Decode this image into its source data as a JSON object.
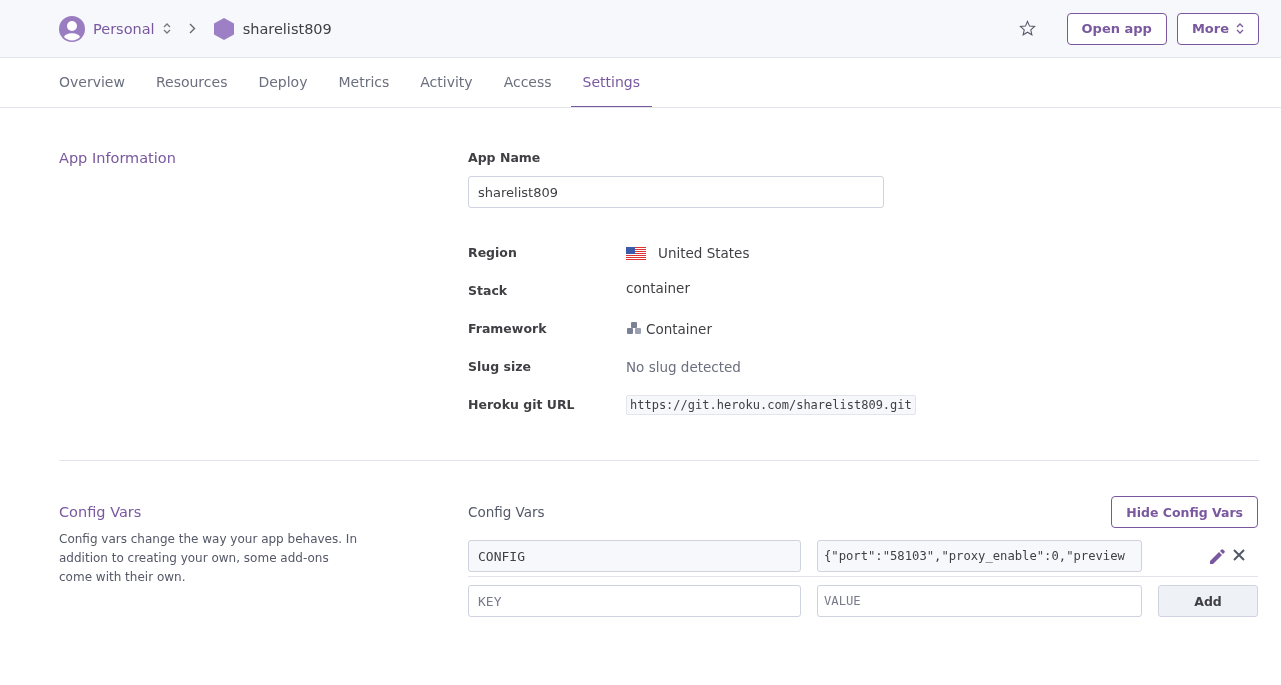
{
  "header": {
    "account": "Personal",
    "app": "sharelist809",
    "buttons": [
      {
        "label": "Open app",
        "kind": "plain"
      },
      {
        "label": "More",
        "kind": "menu"
      }
    ]
  },
  "tabs": [
    {
      "label": "Overview",
      "selected": false
    },
    {
      "label": "Resources",
      "selected": false
    },
    {
      "label": "Deploy",
      "selected": false
    },
    {
      "label": "Metrics",
      "selected": false
    },
    {
      "label": "Activity",
      "selected": false
    },
    {
      "label": "Access",
      "selected": false
    },
    {
      "label": "Settings",
      "selected": true
    }
  ],
  "app_information": {
    "title": "App Information",
    "app_name_label": "App Name",
    "app_name": "sharelist809",
    "rows": [
      {
        "label": "Region",
        "value": "United States",
        "kind": "flag"
      },
      {
        "label": "Stack",
        "value": "container",
        "kind": "plain"
      },
      {
        "label": "Framework",
        "value": "Container",
        "kind": "framework"
      },
      {
        "label": "Slug size",
        "value": "No slug detected",
        "kind": "muted"
      },
      {
        "label": "Heroku git URL",
        "value": "https://git.heroku.com/sharelist809.git",
        "kind": "code"
      }
    ]
  },
  "config_vars": {
    "title": "Config Vars",
    "description": "Config vars change the way your app behaves. In addition to creating your own, some add-ons come with their own.",
    "heading": "Config Vars",
    "toggle_button": "Hide Config Vars",
    "vars": [
      {
        "key": "CONFIG",
        "value": "{\"port\":\"58103\",\"proxy_enable\":0,\"preview"
      }
    ],
    "new": {
      "key_placeholder": "KEY",
      "value_placeholder": "VALUE",
      "button": "Add"
    }
  }
}
